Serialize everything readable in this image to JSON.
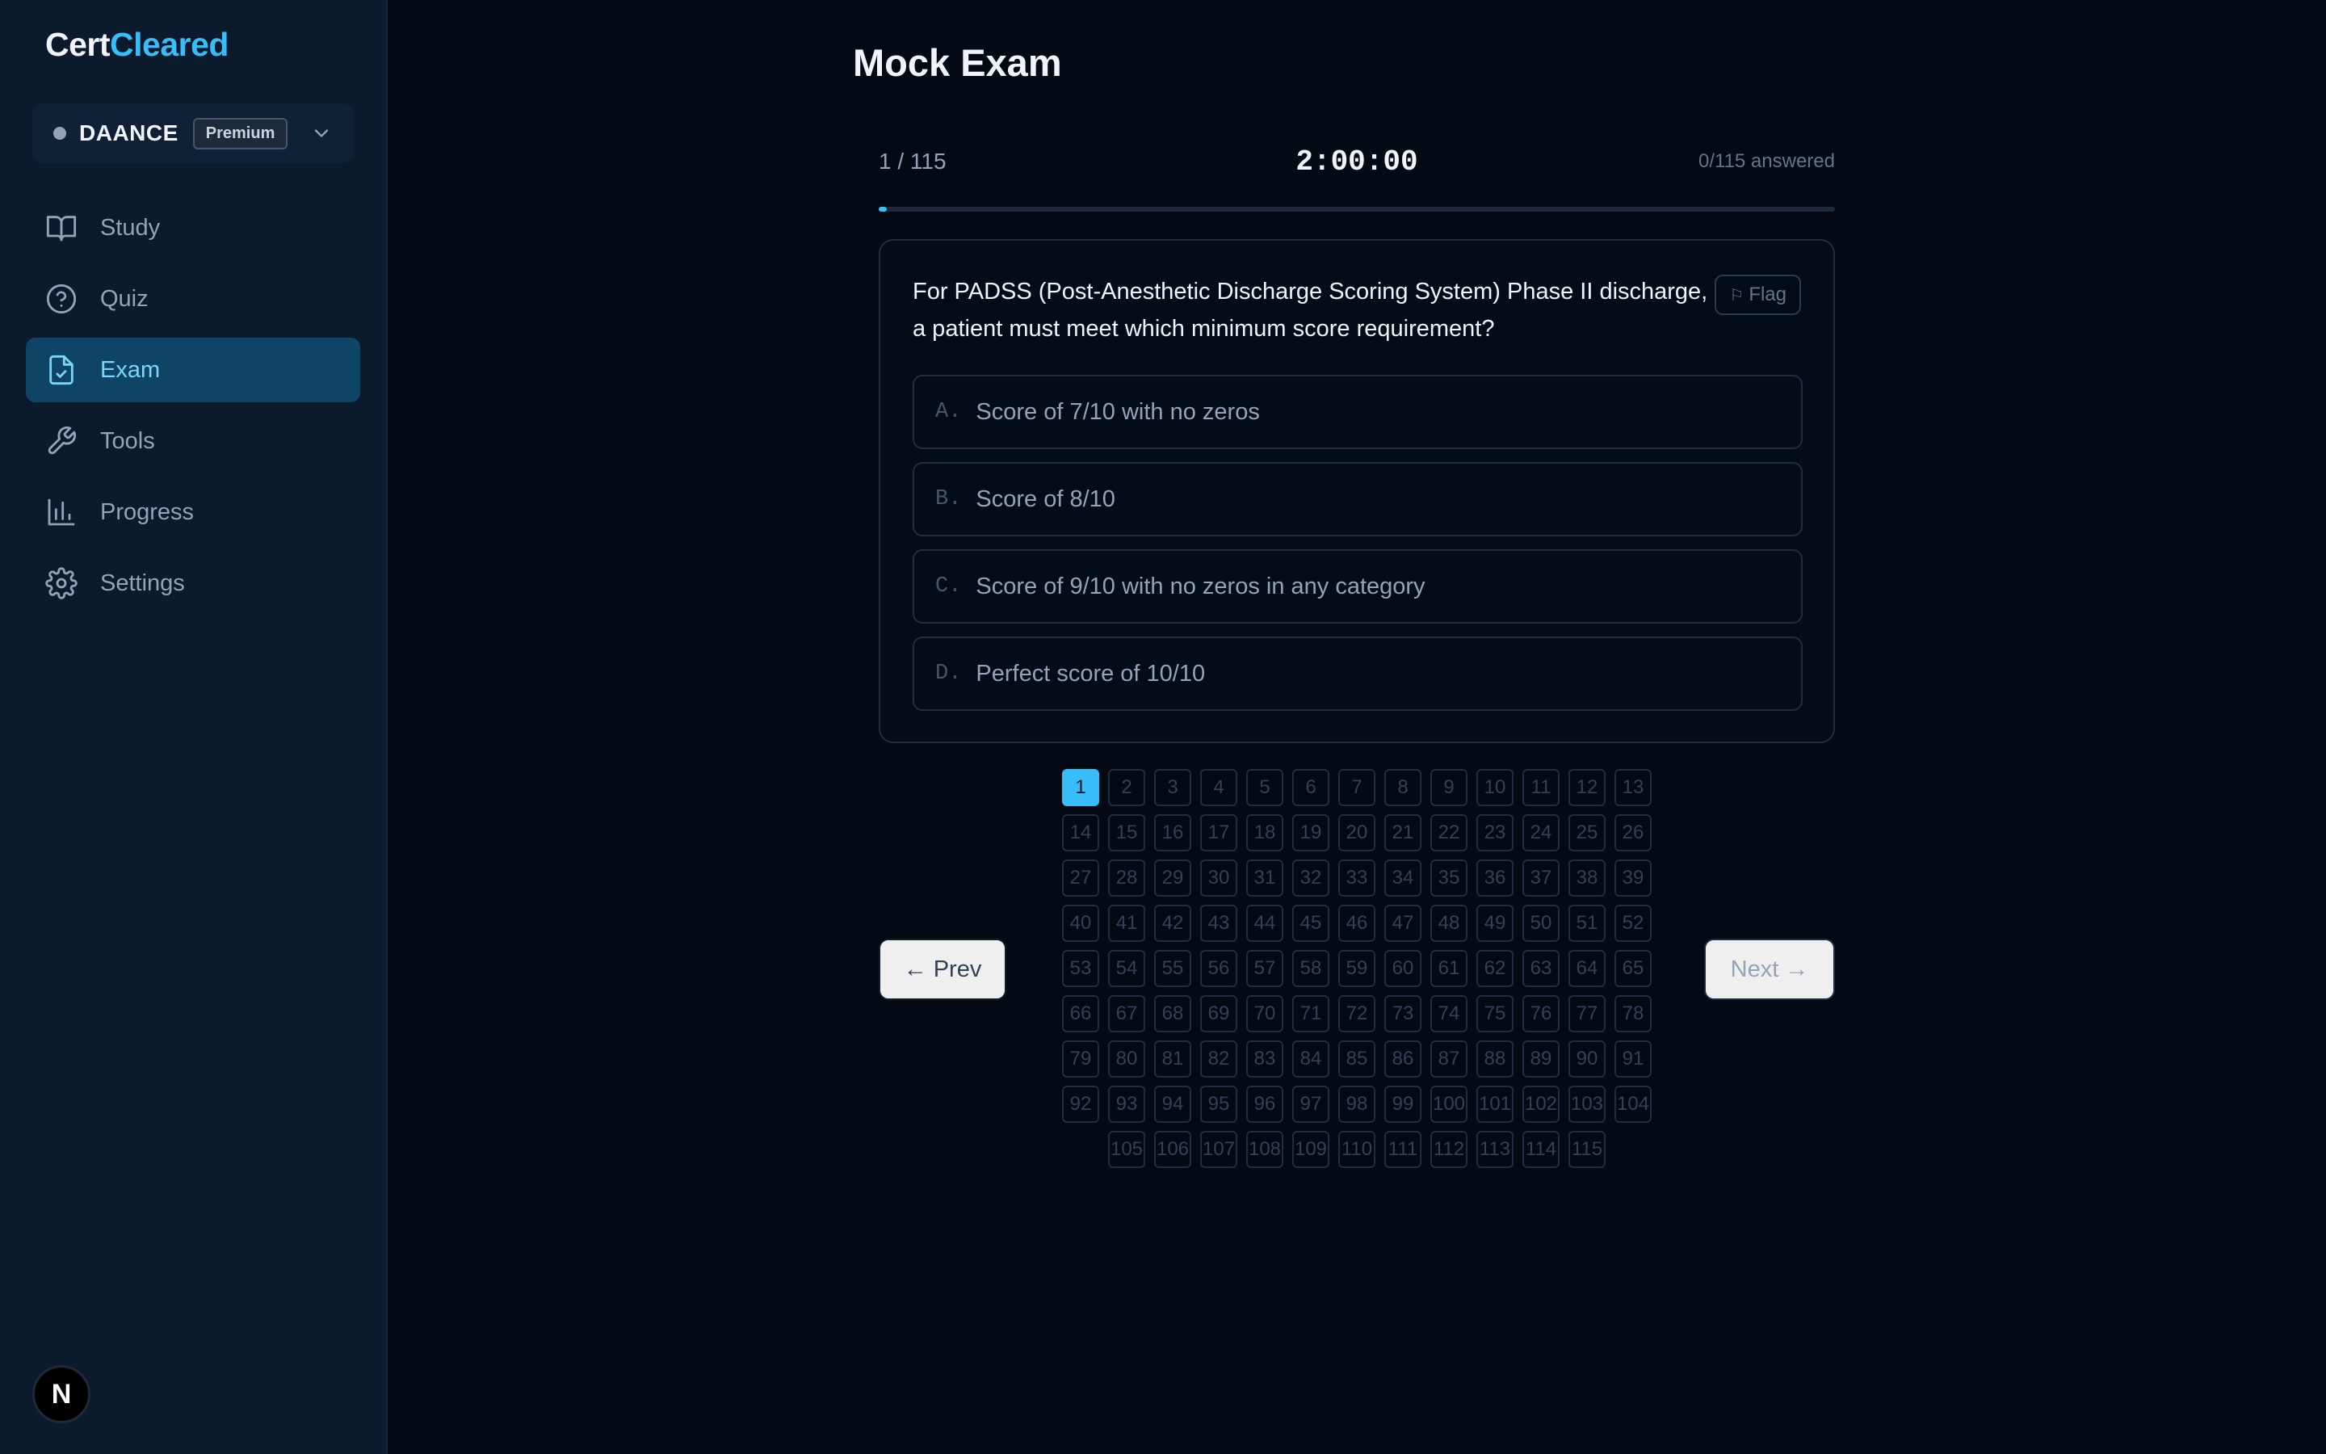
{
  "brand": {
    "part1": "Cert",
    "part2": "Cleared"
  },
  "cert_selector": {
    "name": "DAANCE",
    "badge": "Premium"
  },
  "sidebar": {
    "items": [
      {
        "label": "Study",
        "icon": "book-icon"
      },
      {
        "label": "Quiz",
        "icon": "help-circle-icon"
      },
      {
        "label": "Exam",
        "icon": "file-check-icon",
        "active": true
      },
      {
        "label": "Tools",
        "icon": "wrench-icon"
      },
      {
        "label": "Progress",
        "icon": "bar-chart-icon"
      },
      {
        "label": "Settings",
        "icon": "gear-icon"
      }
    ]
  },
  "avatar_letter": "N",
  "exam": {
    "title": "Mock Exam",
    "counter": "1 / 115",
    "timer": "2:00:00",
    "answered": "0/115 answered",
    "progress_fraction": 0.0087,
    "question": "For PADSS (Post-Anesthetic Discharge Scoring System) Phase II discharge, a patient must meet which minimum score requirement?",
    "flag_label": "Flag",
    "options": [
      {
        "letter": "A.",
        "text": "Score of 7/10 with no zeros"
      },
      {
        "letter": "B.",
        "text": "Score of 8/10"
      },
      {
        "letter": "C.",
        "text": "Score of 9/10 with no zeros in any category"
      },
      {
        "letter": "D.",
        "text": "Perfect score of 10/10"
      }
    ],
    "prev_label": "← Prev",
    "next_label": "Next →",
    "total_questions": 115,
    "current_question": 1
  },
  "colors": {
    "accent": "#38bdf8",
    "sidebar_bg": "#0b1a2c",
    "main_bg": "#030a14",
    "active_nav_bg": "#0e4566"
  }
}
